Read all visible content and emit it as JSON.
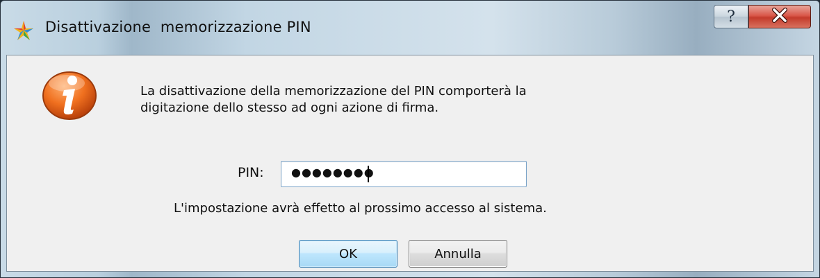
{
  "window": {
    "title": "Disattivazione  memorizzazione PIN",
    "help_symbol": "?",
    "close_icon": "close-icon",
    "app_icon": "star-icon",
    "colors": {
      "close_button": "#c9402f",
      "ok_border": "#3c7fb1",
      "dialog_bg": "#f0f0f0"
    }
  },
  "dialog": {
    "icon": "info-icon",
    "message_line1": "La disattivazione della memorizzazione del PIN comporterà la",
    "message_line2": "digitazione dello stesso ad ogni azione di firma.",
    "pin_label": "PIN:",
    "pin_value": "●●●●●●●●",
    "note": "L'impostazione avrà effetto al prossimo accesso al sistema.",
    "ok_label": "OK",
    "cancel_label": "Annulla"
  }
}
